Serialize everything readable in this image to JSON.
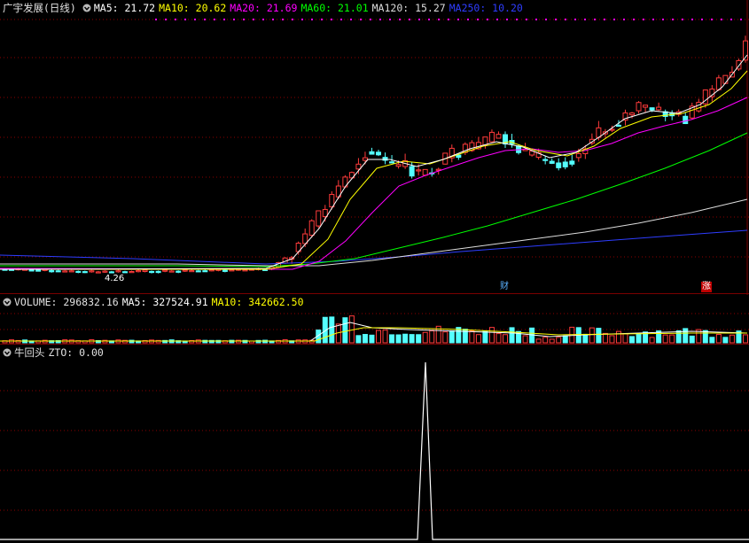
{
  "main": {
    "title": "广宇发展(日线)",
    "ma": [
      {
        "label": "MA5: 21.72",
        "color": "#ffffff"
      },
      {
        "label": "MA10: 20.62",
        "color": "#ffff00"
      },
      {
        "label": "MA20: 21.69",
        "color": "#ff00ff"
      },
      {
        "label": "MA60: 21.01",
        "color": "#00ff00"
      },
      {
        "label": "MA120: 15.27",
        "color": "#dddddd"
      },
      {
        "label": "MA250: 10.20",
        "color": "#2e3dff"
      }
    ],
    "low_label": "4.26",
    "event_tag_1": "财",
    "event_tag_2": "涨"
  },
  "volume": {
    "title": "VOLUME: 296832.16",
    "ma5": "MA5: 327524.91",
    "ma10": "MA10: 342662.50"
  },
  "indicator": {
    "title": "牛回头",
    "value": "ZTO: 0.00"
  },
  "colors": {
    "up": "#ff3b3b",
    "down": "#54ffff",
    "grid": "#8b0000",
    "ma5": "#ffffff",
    "ma10": "#ffff00",
    "ma20": "#ff00ff",
    "ma60": "#00ff00",
    "ma120": "#dddddd",
    "ma250": "#2e3dff"
  }
}
